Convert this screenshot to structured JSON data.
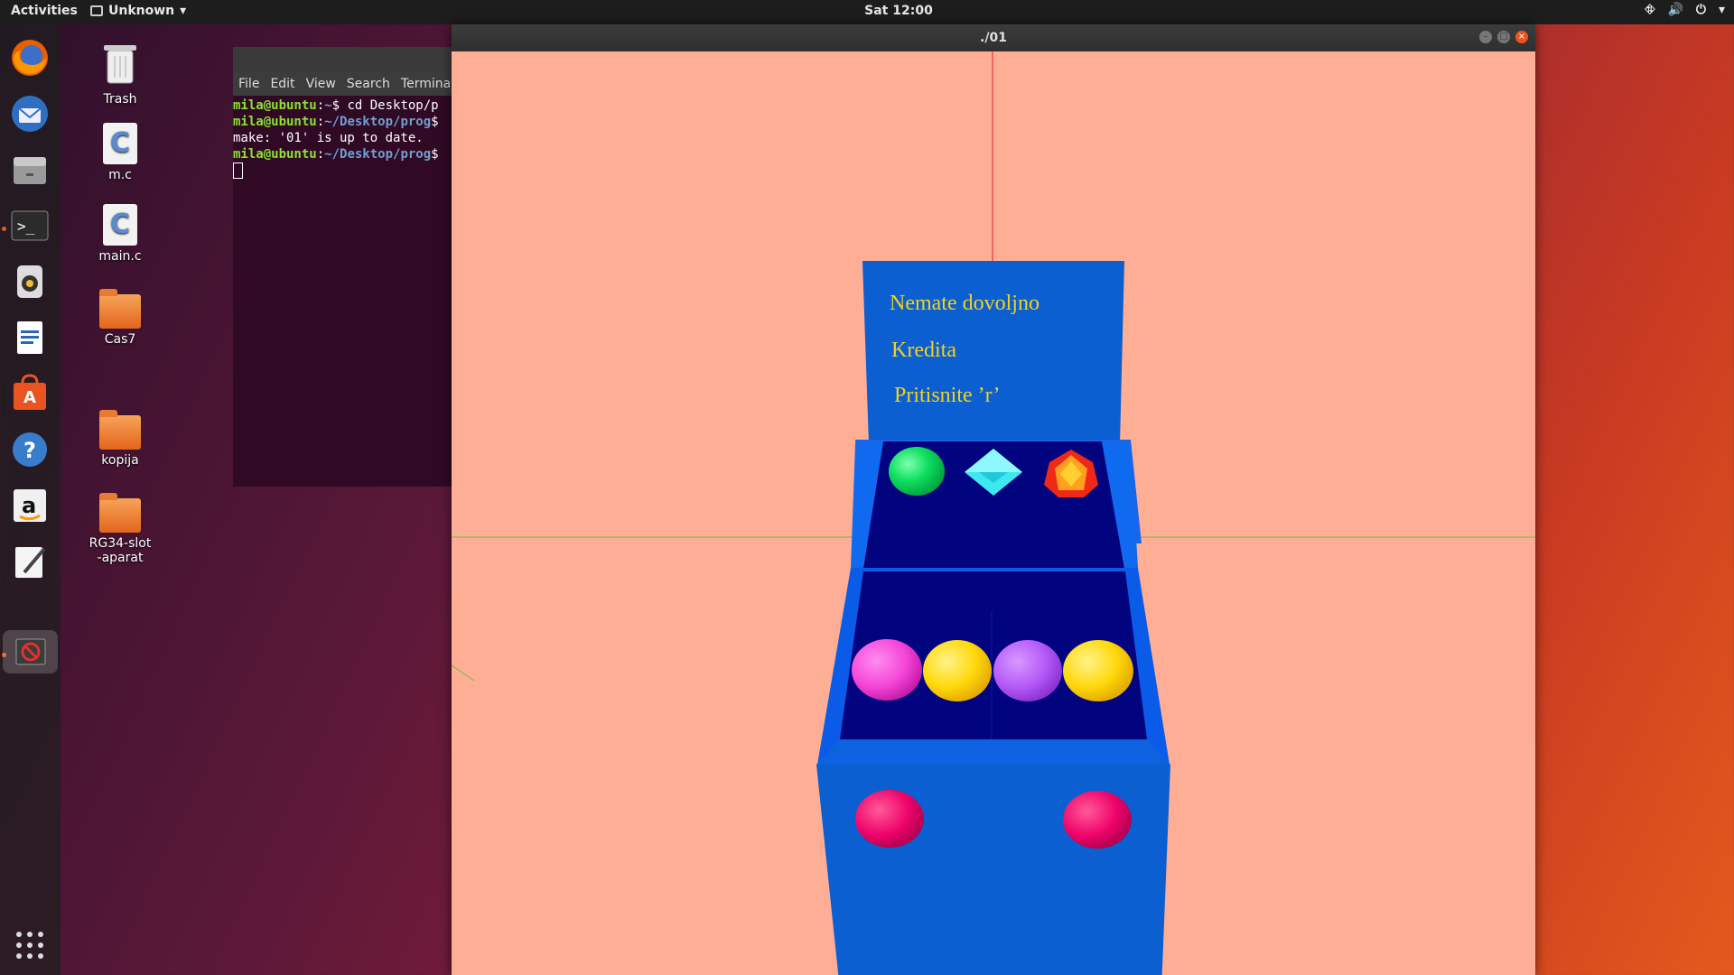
{
  "topbar": {
    "activities": "Activities",
    "app_name": "Unknown",
    "clock": "Sat 12:00",
    "tray_icons": [
      "network-icon",
      "volume-icon",
      "power-icon",
      "chevron-down-icon"
    ]
  },
  "dock": {
    "items": [
      {
        "name": "firefox-icon"
      },
      {
        "name": "thunderbird-icon"
      },
      {
        "name": "files-icon"
      },
      {
        "name": "terminal-icon"
      },
      {
        "name": "rhythmbox-icon"
      },
      {
        "name": "writer-icon"
      },
      {
        "name": "software-icon"
      },
      {
        "name": "help-icon"
      },
      {
        "name": "amazon-icon"
      },
      {
        "name": "text-editor-icon"
      },
      {
        "name": "app-01-icon"
      },
      {
        "name": "show-apps-icon"
      }
    ]
  },
  "desktop": {
    "icons": [
      {
        "label": "Trash",
        "type": "trash"
      },
      {
        "label": "m.c",
        "type": "cfile"
      },
      {
        "label": "main.c",
        "type": "cfile"
      },
      {
        "label": "Cas7",
        "type": "folder"
      },
      {
        "label": "kopija",
        "type": "folder"
      },
      {
        "label": "RG34-slot-aparat",
        "type": "folder"
      }
    ]
  },
  "terminal": {
    "menu": [
      "File",
      "Edit",
      "View",
      "Search",
      "Terminal"
    ],
    "lines": [
      {
        "user": "mila@ubuntu",
        "path": "~",
        "cmd": "$ cd Desktop/p"
      },
      {
        "user": "mila@ubuntu",
        "path": "~/Desktop/prog",
        "cmd": "$"
      },
      {
        "text": "make: '01' is up to date."
      },
      {
        "user": "mila@ubuntu",
        "path": "~/Desktop/prog",
        "cmd": "$"
      }
    ]
  },
  "window": {
    "title": "./01",
    "buttons": [
      "minimize-button",
      "maximize-button",
      "close-button"
    ]
  },
  "scene": {
    "sign_lines": [
      "Nemate dovoljno",
      "Kredita",
      "Pritisnite ’r’"
    ],
    "colors": {
      "background": "#ffae96",
      "cabinet": "#0b5fd0",
      "screen": "#02037f",
      "text": "#f2d21d"
    }
  }
}
